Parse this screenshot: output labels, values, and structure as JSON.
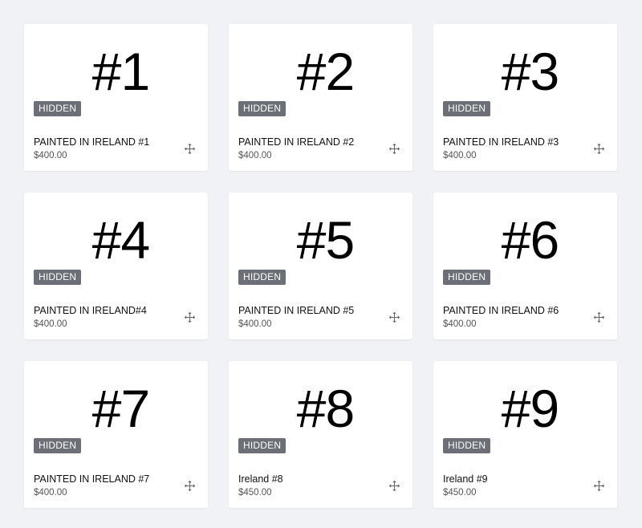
{
  "products": [
    {
      "thumb_label": "#1",
      "badge": "HIDDEN",
      "title": "PAINTED IN IRELAND #1",
      "price": "$400.00",
      "icon": "move-icon"
    },
    {
      "thumb_label": "#2",
      "badge": "HIDDEN",
      "title": "PAINTED IN IRELAND #2",
      "price": "$400.00",
      "icon": "move-icon"
    },
    {
      "thumb_label": "#3",
      "badge": "HIDDEN",
      "title": "PAINTED IN IRELAND #3",
      "price": "$400.00",
      "icon": "move-icon"
    },
    {
      "thumb_label": "#4",
      "badge": "HIDDEN",
      "title": "PAINTED IN IRELAND#4",
      "price": "$400.00",
      "icon": "move-icon"
    },
    {
      "thumb_label": "#5",
      "badge": "HIDDEN",
      "title": "PAINTED IN IRELAND #5",
      "price": "$400.00",
      "icon": "move-icon"
    },
    {
      "thumb_label": "#6",
      "badge": "HIDDEN",
      "title": "PAINTED IN IRELAND #6",
      "price": "$400.00",
      "icon": "move-icon"
    },
    {
      "thumb_label": "#7",
      "badge": "HIDDEN",
      "title": "PAINTED IN IRELAND #7",
      "price": "$400.00",
      "icon": "move-icon"
    },
    {
      "thumb_label": "#8",
      "badge": "HIDDEN",
      "title": "Ireland #8",
      "price": "$450.00",
      "icon": "move-icon"
    },
    {
      "thumb_label": "#9",
      "badge": "HIDDEN",
      "title": "Ireland #9",
      "price": "$450.00",
      "icon": "move-icon"
    }
  ],
  "colors": {
    "page_background": "#f1f2f5",
    "card_background": "#ffffff",
    "badge_background": "#6c6f76",
    "badge_text": "#ffffff"
  }
}
